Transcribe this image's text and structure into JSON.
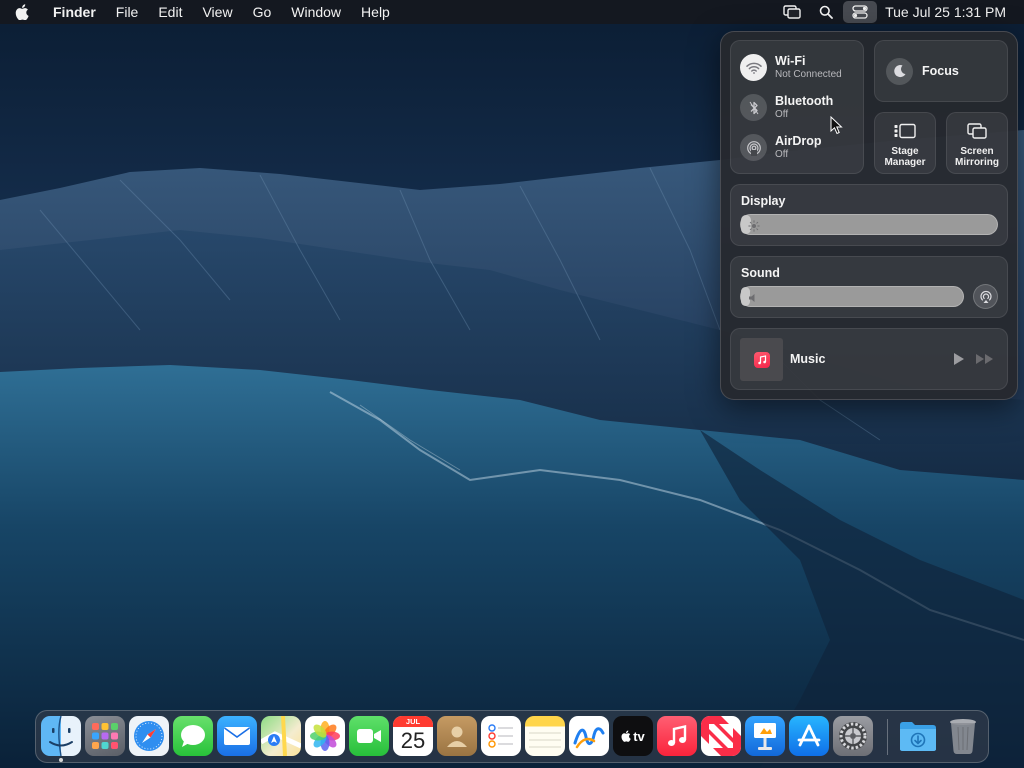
{
  "colors": {
    "menubar_bg": "#16181e",
    "panel_bg": "#26282e",
    "accent_red": "#fa233b",
    "focus_moon": "#dcdce0"
  },
  "menubar": {
    "apple_icon": "apple-logo-icon",
    "app_name": "Finder",
    "menus": [
      "File",
      "Edit",
      "View",
      "Go",
      "Window",
      "Help"
    ],
    "status_icons": [
      "screen-mirroring-icon",
      "spotlight-search-icon",
      "control-center-icon"
    ],
    "clock": "Tue Jul 25  1:31 PM"
  },
  "control_center": {
    "wifi": {
      "title": "Wi-Fi",
      "status": "Not Connected",
      "icon": "wifi-icon"
    },
    "bluetooth": {
      "title": "Bluetooth",
      "status": "Off",
      "icon": "bluetooth-icon"
    },
    "airdrop": {
      "title": "AirDrop",
      "status": "Off",
      "icon": "airdrop-icon"
    },
    "focus": {
      "label": "Focus",
      "icon": "moon-icon"
    },
    "stage_manager": {
      "label_line1": "Stage",
      "label_line2": "Manager",
      "icon": "stage-manager-icon"
    },
    "screen_mirroring": {
      "label_line1": "Screen",
      "label_line2": "Mirroring",
      "icon": "screen-mirroring-icon"
    },
    "display": {
      "label": "Display",
      "brightness_fraction": 0.04
    },
    "sound": {
      "label": "Sound",
      "volume_fraction": 0.04
    },
    "now_playing": {
      "label": "Music",
      "icon": "music-app-icon"
    }
  },
  "dock": {
    "apps": [
      {
        "name": "Finder",
        "icon": "finder-icon",
        "running": true
      },
      {
        "name": "Launchpad",
        "icon": "launchpad-icon",
        "running": false
      },
      {
        "name": "Safari",
        "icon": "safari-icon",
        "running": false
      },
      {
        "name": "Messages",
        "icon": "messages-icon",
        "running": false
      },
      {
        "name": "Mail",
        "icon": "mail-icon",
        "running": false
      },
      {
        "name": "Maps",
        "icon": "maps-icon",
        "running": false
      },
      {
        "name": "Photos",
        "icon": "photos-icon",
        "running": false
      },
      {
        "name": "FaceTime",
        "icon": "facetime-icon",
        "running": false
      },
      {
        "name": "Calendar",
        "icon": "calendar-icon",
        "running": false
      },
      {
        "name": "Contacts",
        "icon": "contacts-icon",
        "running": false
      },
      {
        "name": "Reminders",
        "icon": "reminders-icon",
        "running": false
      },
      {
        "name": "Notes",
        "icon": "notes-icon",
        "running": false
      },
      {
        "name": "Freeform",
        "icon": "freeform-icon",
        "running": false
      },
      {
        "name": "TV",
        "icon": "apple-tv-icon",
        "running": false
      },
      {
        "name": "Music",
        "icon": "music-icon",
        "running": false
      },
      {
        "name": "News",
        "icon": "news-icon",
        "running": false
      },
      {
        "name": "Keynote",
        "icon": "keynote-icon",
        "running": false
      },
      {
        "name": "App Store",
        "icon": "app-store-icon",
        "running": false
      },
      {
        "name": "System Settings",
        "icon": "system-settings-icon",
        "running": false
      },
      {
        "name": "Downloads",
        "icon": "downloads-folder-icon",
        "running": false
      },
      {
        "name": "Trash",
        "icon": "trash-icon",
        "running": false
      }
    ],
    "calendar_month": "JUL",
    "calendar_day": "25",
    "tv_label": "tv"
  }
}
